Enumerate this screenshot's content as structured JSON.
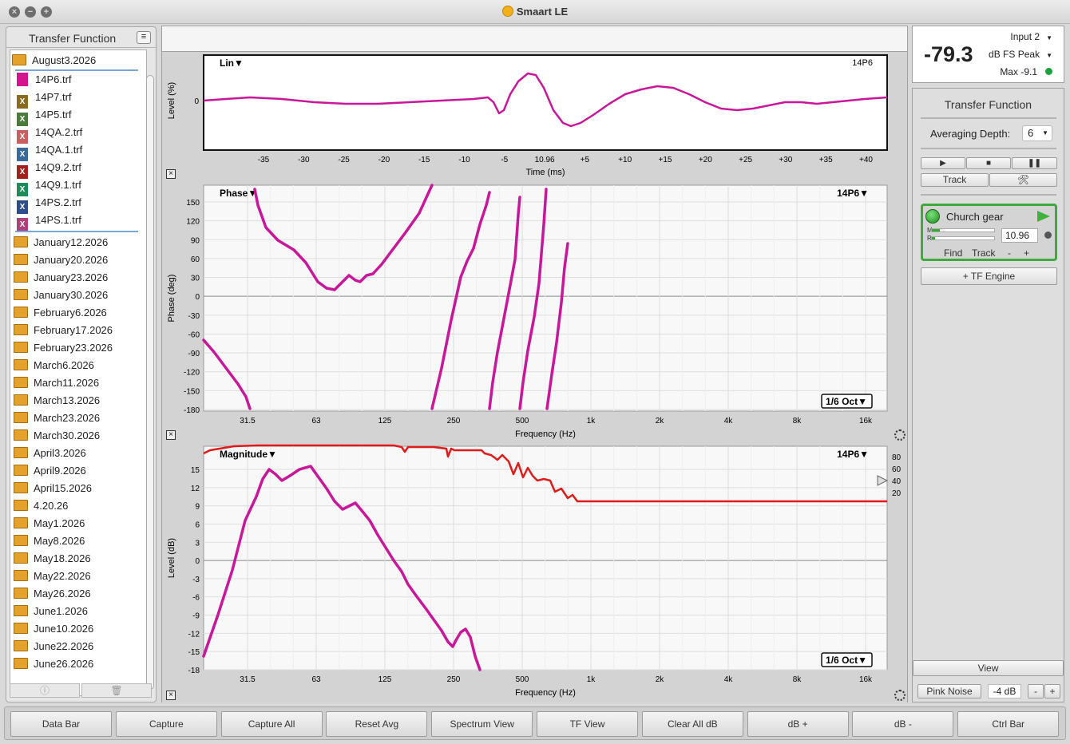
{
  "window": {
    "title": "Smaart LE"
  },
  "sidebar": {
    "title": "Transfer Function",
    "open_folder": "August3.2026",
    "files": [
      {
        "name": "14P6.trf",
        "color": "#d4148f",
        "icon": "solid"
      },
      {
        "name": "14P7.trf",
        "color": "#8a6a1e",
        "icon": "x"
      },
      {
        "name": "14P5.trf",
        "color": "#4b7a3a",
        "icon": "x"
      },
      {
        "name": "14QA.2.trf",
        "color": "#c76060",
        "icon": "x"
      },
      {
        "name": "14QA.1.trf",
        "color": "#3a6a9c",
        "icon": "x"
      },
      {
        "name": "14Q9.2.trf",
        "color": "#a1201e",
        "icon": "x"
      },
      {
        "name": "14Q9.1.trf",
        "color": "#1f8a5a",
        "icon": "x"
      },
      {
        "name": "14PS.2.trf",
        "color": "#2c4c8a",
        "icon": "x"
      },
      {
        "name": "14PS.1.trf",
        "color": "#b0407a",
        "icon": "x"
      }
    ],
    "folders": [
      "January12.2026",
      "January20.2026",
      "January23.2026",
      "January30.2026",
      "February6.2026",
      "February17.2026",
      "February23.2026",
      "March6.2026",
      "March11.2026",
      "March13.2026",
      "March23.2026",
      "March30.2026",
      "April3.2026",
      "April9.2026",
      "April15.2026",
      "4.20.26",
      "May1.2026",
      "May8.2026",
      "May18.2026",
      "May22.2026",
      "May26.2026",
      "June1.2026",
      "June10.2026",
      "June22.2026",
      "June26.2026"
    ]
  },
  "impulse_plot": {
    "title": "Lin",
    "trace_label": "14P6",
    "ylabel": "Level (%)",
    "ytick": "0",
    "xlabel": "Time (ms)",
    "xticks": [
      "-35",
      "-30",
      "-25",
      "-20",
      "-15",
      "-10",
      "-5",
      "10.96",
      "+5",
      "+10",
      "+15",
      "+20",
      "+25",
      "+30",
      "+35",
      "+40"
    ]
  },
  "phase_plot": {
    "title": "Phase",
    "trace_label": "14P6",
    "ylabel": "Phase (deg)",
    "yticks": [
      "150",
      "120",
      "90",
      "60",
      "30",
      "0",
      "-30",
      "-60",
      "-90",
      "-120",
      "-150",
      "-180"
    ],
    "xlabel": "Frequency (Hz)",
    "xticks": [
      "31.5",
      "63",
      "125",
      "250",
      "500",
      "1k",
      "2k",
      "4k",
      "8k",
      "16k"
    ],
    "smoothing": "1/6 Oct"
  },
  "magnitude_plot": {
    "title": "Magnitude",
    "trace_label": "14P6",
    "ylabel": "Level (dB)",
    "yticks": [
      "15",
      "12",
      "9",
      "6",
      "3",
      "0",
      "-3",
      "-6",
      "-9",
      "-12",
      "-15",
      "-18"
    ],
    "coherence_ticks": [
      "80",
      "60",
      "40",
      "20"
    ],
    "xlabel": "Frequency (Hz)",
    "xticks": [
      "31.5",
      "63",
      "125",
      "250",
      "500",
      "1k",
      "2k",
      "4k",
      "8k",
      "16k"
    ],
    "smoothing": "1/6 Oct"
  },
  "meter": {
    "input": "Input 2",
    "level": "-79.3",
    "mode": "dB FS Peak",
    "max": "Max -9.1"
  },
  "control_panel": {
    "title": "Transfer Function",
    "averaging_label": "Averaging Depth:",
    "averaging_value": "6",
    "track_label": "Track",
    "engine": {
      "name": "Church gear",
      "delay_value": "10.96",
      "m_label": "M",
      "r_label": "R",
      "find_label": "Find",
      "track_label": "Track",
      "minus_label": "-",
      "plus_label": "+"
    },
    "add_engine_label": "+ TF Engine",
    "view_label": "View",
    "generator_label": "Pink Noise",
    "generator_level": "-4 dB",
    "gen_minus": "-",
    "gen_plus": "+"
  },
  "bottom_bar": [
    "Data Bar",
    "Capture",
    "Capture All",
    "Reset Avg",
    "Spectrum View",
    "TF View",
    "Clear All dB",
    "dB +",
    "dB -",
    "Ctrl Bar"
  ],
  "colors": {
    "trace": "#c8179a",
    "coherence": "#e01b1b",
    "accent_green": "#3caa3c"
  }
}
